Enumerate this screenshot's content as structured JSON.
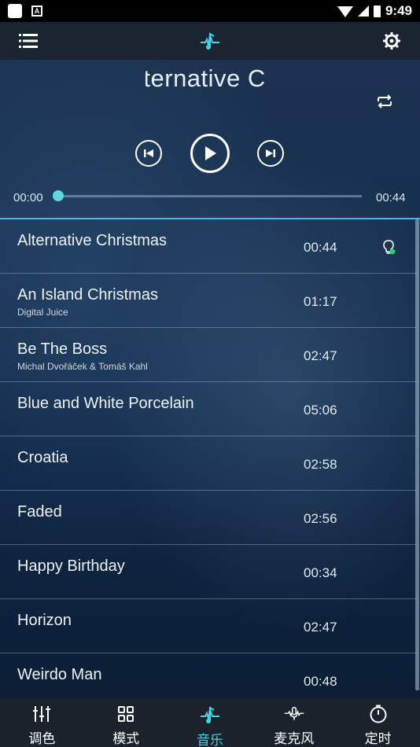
{
  "status_bar": {
    "time": "9:49",
    "notif_icon": "A"
  },
  "header": {
    "menu_icon": "menu-icon",
    "logo_icon": "music-note-icon",
    "settings_icon": "gear-icon"
  },
  "player": {
    "title": "Alternative Christmas",
    "title_visible": "lternative C",
    "current_time": "00:00",
    "total_time": "00:44",
    "progress": 0.0
  },
  "songs": [
    {
      "title": "Alternative Christmas",
      "artist": "",
      "duration": "00:44"
    },
    {
      "title": "An Island Christmas",
      "artist": "Digital Juice",
      "duration": "01:17"
    },
    {
      "title": "Be The Boss",
      "artist": "Michal Dvořáček & Tomáš Kahl",
      "duration": "02:47"
    },
    {
      "title": "Blue and White Porcelain",
      "artist": "",
      "duration": "05:06"
    },
    {
      "title": "Croatia",
      "artist": "",
      "duration": "02:58"
    },
    {
      "title": "Faded",
      "artist": "",
      "duration": "02:56"
    },
    {
      "title": "Happy Birthday",
      "artist": "",
      "duration": "00:34"
    },
    {
      "title": "Horizon",
      "artist": "",
      "duration": "02:47"
    },
    {
      "title": "Weirdo Man",
      "artist": "",
      "duration": "00:48"
    }
  ],
  "nav": [
    {
      "label": "调色",
      "icon": "sliders-icon"
    },
    {
      "label": "模式",
      "icon": "grid-icon"
    },
    {
      "label": "音乐",
      "icon": "music-note-icon"
    },
    {
      "label": "麦克风",
      "icon": "microphone-icon"
    },
    {
      "label": "定时",
      "icon": "timer-icon"
    }
  ],
  "colors": {
    "accent": "#3fd6e3",
    "divider": "#45b9e6",
    "nav_bg": "#1c222b"
  }
}
